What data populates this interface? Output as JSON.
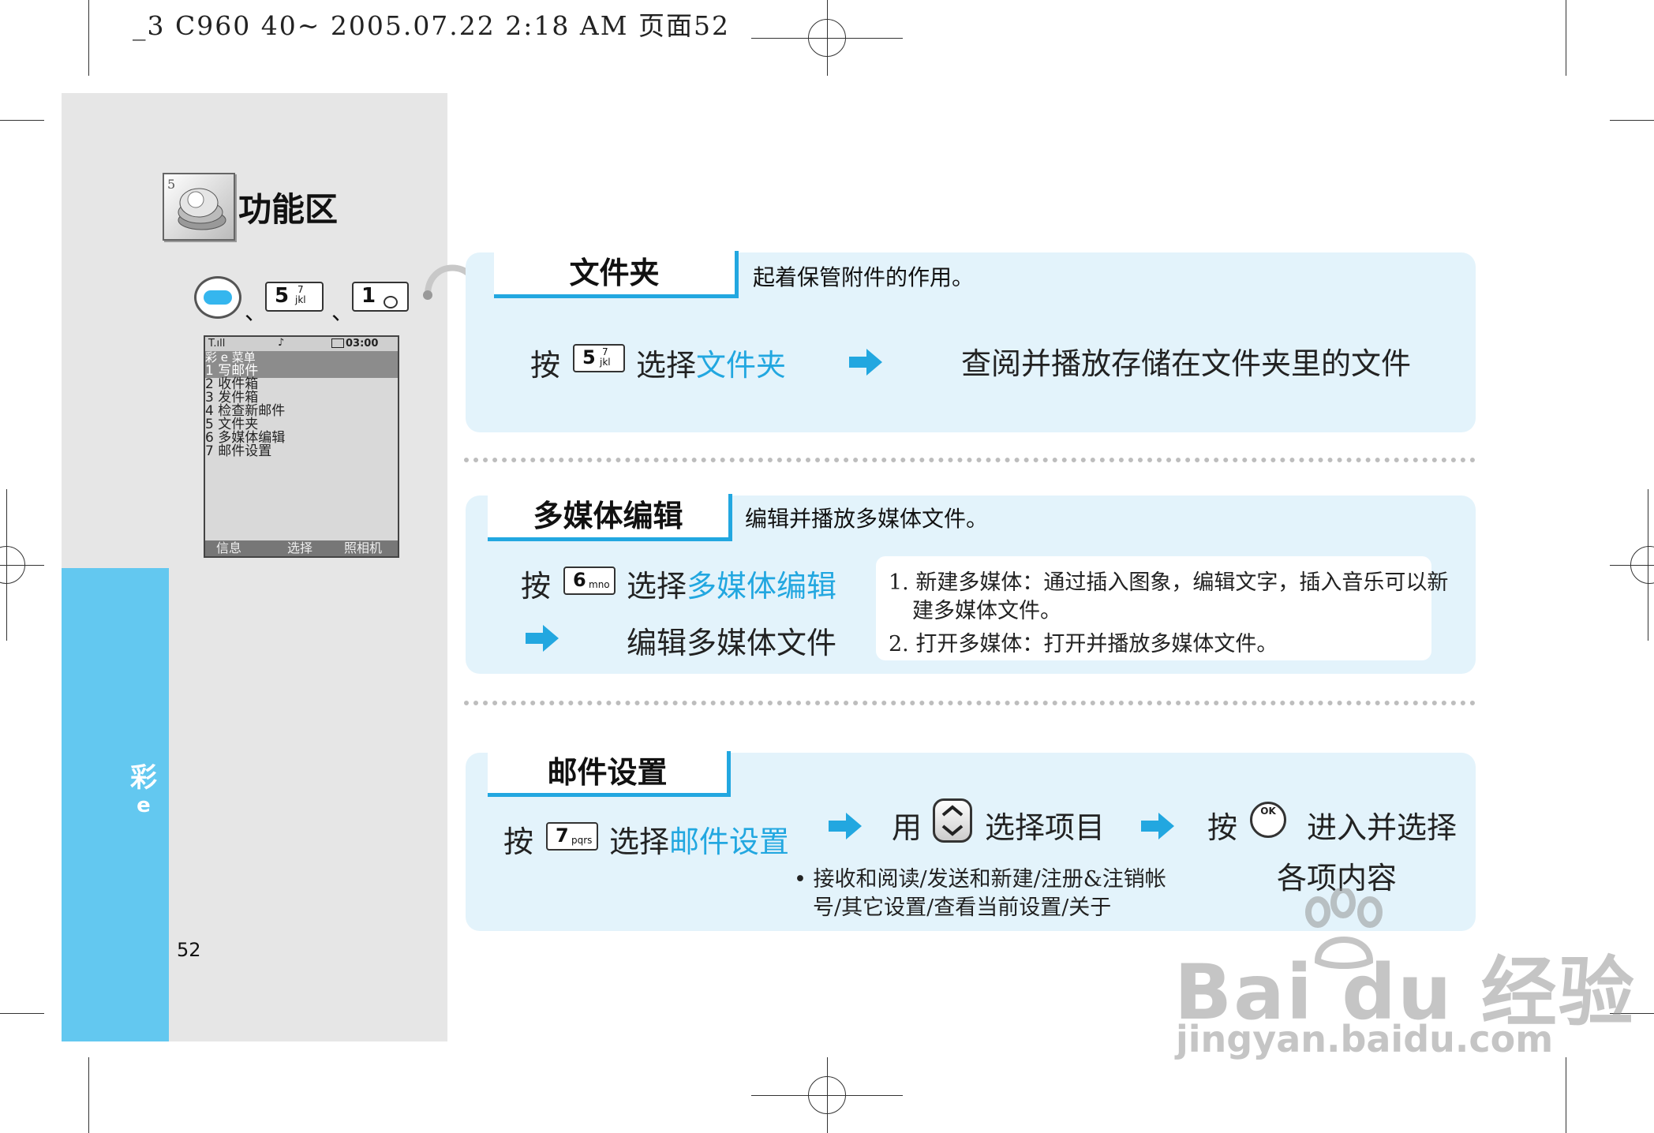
{
  "header": {
    "text": "_3 C960 40~ 2005.07.22 2:18 AM 页面52"
  },
  "section": {
    "title": "功能区",
    "icon": "folder-disc-icon"
  },
  "nav_sequence": [
    {
      "type": "button",
      "icon": "blue-oval-key-icon"
    },
    {
      "sep": "、"
    },
    {
      "num": "5",
      "sub_top": "7",
      "sub_bottom": "jkl"
    },
    {
      "sep": "、"
    },
    {
      "num": "1",
      "sub_top": "",
      "sub_bottom": ""
    }
  ],
  "phone": {
    "status_left": "T.ıll",
    "status_right": "03:00",
    "title": "彩 e 菜单",
    "items": [
      {
        "num": "1",
        "label": "写邮件"
      },
      {
        "num": "2",
        "label": "收件箱"
      },
      {
        "num": "3",
        "label": "发件箱"
      },
      {
        "num": "4",
        "label": "检查新邮件"
      },
      {
        "num": "5",
        "label": "文件夹"
      },
      {
        "num": "6",
        "label": "多媒体编辑"
      },
      {
        "num": "7",
        "label": "邮件设置"
      }
    ],
    "softkeys": {
      "left": "信息",
      "center": "选择",
      "right": "照相机"
    }
  },
  "side": {
    "label1": "彩",
    "label2": "e"
  },
  "page_number": "52",
  "sections": {
    "folder": {
      "tab": "文件夹",
      "desc": "起着保管附件的作用。",
      "press": "按",
      "key": {
        "num": "5",
        "sub_top": "7",
        "sub_bottom": "jkl"
      },
      "select": "选择",
      "select_item": "文件夹",
      "result": "查阅并播放存储在文件夹里的文件"
    },
    "multimedia": {
      "tab": "多媒体编辑",
      "desc": "编辑并播放多媒体文件。",
      "press": "按",
      "key": {
        "num": "6",
        "sub_top": "",
        "sub_bottom": "mno"
      },
      "select": "选择",
      "select_item": "多媒体编辑",
      "result": "编辑多媒体文件",
      "notes": [
        "1. 新建多媒体：通过插入图象，编辑文字，插入音乐可以新",
        "建多媒体文件。",
        "2. 打开多媒体：打开并播放多媒体文件。"
      ]
    },
    "mail_settings": {
      "tab": "邮件设置",
      "press": "按",
      "key": {
        "num": "7",
        "sub_top": "",
        "sub_bottom": "pqrs"
      },
      "select": "选择",
      "select_item": "邮件设置",
      "use": "用",
      "select_project": "选择项目",
      "press2": "按",
      "ok_label": "OK",
      "enter": "进入并选择",
      "enter2": "各项内容",
      "bullet_line1": "• 接收和阅读/发送和新建/注册&注销帐",
      "bullet_line2": "号/其它设置/查看当前设置/关于"
    }
  },
  "watermark": {
    "brand": "Bai du 经验",
    "url": "jingyan.baidu.com"
  },
  "colors": {
    "accent": "#22a7e0",
    "panel": "#e3f3fb",
    "side_blue": "#63c8f0",
    "left_gray": "#e6e6e6"
  }
}
